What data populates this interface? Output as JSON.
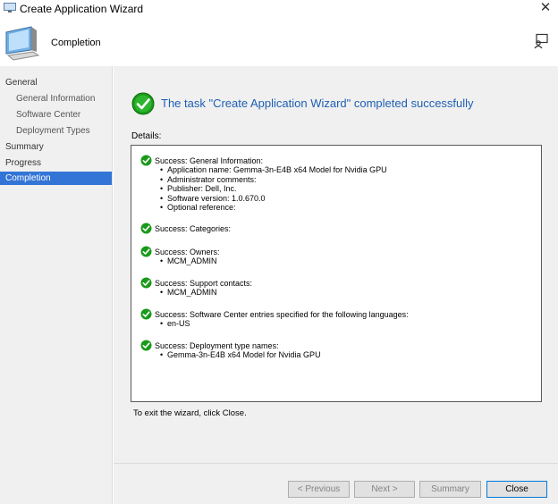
{
  "window": {
    "title": "Create Application Wizard"
  },
  "header": {
    "title": "Completion"
  },
  "nav": {
    "items": [
      {
        "label": "General",
        "sub": false,
        "active": false
      },
      {
        "label": "General Information",
        "sub": true,
        "active": false
      },
      {
        "label": "Software Center",
        "sub": true,
        "active": false
      },
      {
        "label": "Deployment Types",
        "sub": true,
        "active": false
      },
      {
        "label": "Summary",
        "sub": false,
        "active": false
      },
      {
        "label": "Progress",
        "sub": false,
        "active": false
      },
      {
        "label": "Completion",
        "sub": false,
        "active": true
      }
    ]
  },
  "main": {
    "status": "The task \"Create Application Wizard\" completed successfully",
    "details_label": "Details:",
    "exit_text": "To exit the wizard, click Close.",
    "entries": [
      {
        "head": "Success: General Information:",
        "items": [
          "Application name: Gemma-3n-E4B x64 Model for Nvidia GPU",
          "Administrator comments:",
          "Publisher: Dell, Inc.",
          "Software version: 1.0.670.0",
          "Optional reference:"
        ]
      },
      {
        "head": "Success: Categories:",
        "items": []
      },
      {
        "head": "Success: Owners:",
        "items": [
          "MCM_ADMIN"
        ]
      },
      {
        "head": "Success: Support contacts:",
        "items": [
          "MCM_ADMIN"
        ]
      },
      {
        "head": "Success: Software Center entries specified for the following languages:",
        "items": [
          "en-US"
        ]
      },
      {
        "head": "Success: Deployment type names:",
        "items": [
          "Gemma-3n-E4B x64 Model for Nvidia GPU"
        ]
      }
    ]
  },
  "buttons": {
    "previous": "< Previous",
    "next": "Next >",
    "summary": "Summary",
    "close": "Close"
  },
  "colors": {
    "accent": "#3375d6",
    "status_text": "#1e5fb4",
    "success_green": "#1a9a1a"
  }
}
